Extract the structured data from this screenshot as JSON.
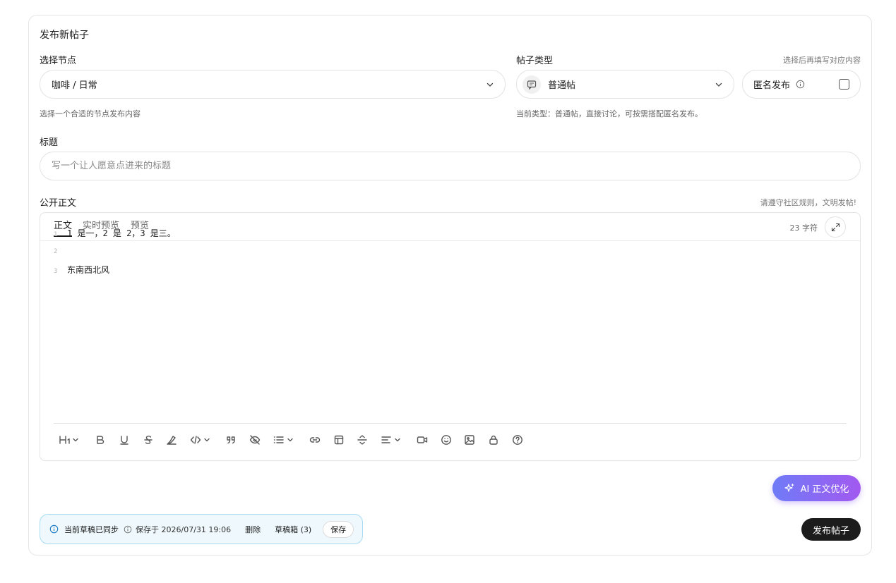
{
  "page": {
    "title": "发布新帖子"
  },
  "node": {
    "label": "选择节点",
    "value": "咖啡 / 日常",
    "hint": "选择一个合适的节点发布内容"
  },
  "post_type": {
    "label": "帖子类型",
    "side_hint": "选择后再填写对应内容",
    "value": "普通帖",
    "hint": "当前类型：普通帖，直接讨论，可按需搭配匿名发布。"
  },
  "anonymous": {
    "label": "匿名发布",
    "checked": false
  },
  "title_field": {
    "label": "标题",
    "placeholder": "写一个让人愿意点进来的标题",
    "value": ""
  },
  "body": {
    "label": "公开正文",
    "rules_hint": "请遵守社区规则，文明发帖!",
    "tabs": [
      "正文",
      "实时预览",
      "预览"
    ],
    "active_tab": "正文",
    "char_count": "23 字符",
    "lines": [
      {
        "num": "1",
        "text": "1 是一，2 是 2，3 是三。"
      },
      {
        "num": "2",
        "text": ""
      },
      {
        "num": "3",
        "text": "东南西北风"
      }
    ]
  },
  "toolbar": {
    "items": [
      "heading",
      "bold",
      "underline",
      "strikethrough",
      "highlight",
      "code",
      "quote",
      "spoiler",
      "list",
      "link",
      "table",
      "divider",
      "align",
      "video",
      "emoji",
      "image",
      "lock",
      "help"
    ]
  },
  "ai_button": {
    "label": "AI 正文优化"
  },
  "draft": {
    "status": "当前草稿已同步",
    "saved_at": "保存于 2026/07/31 19:06",
    "delete_label": "删除",
    "drafts_label": "草稿箱 (3)",
    "save_label": "保存"
  },
  "publish": {
    "label": "发布帖子"
  },
  "colors": {
    "accent_start": "#6f7bf7",
    "accent_end": "#a259f0",
    "publish_bg": "#1c1c1c",
    "draft_bg": "#eef8fd",
    "draft_border": "#a6dcf2"
  }
}
